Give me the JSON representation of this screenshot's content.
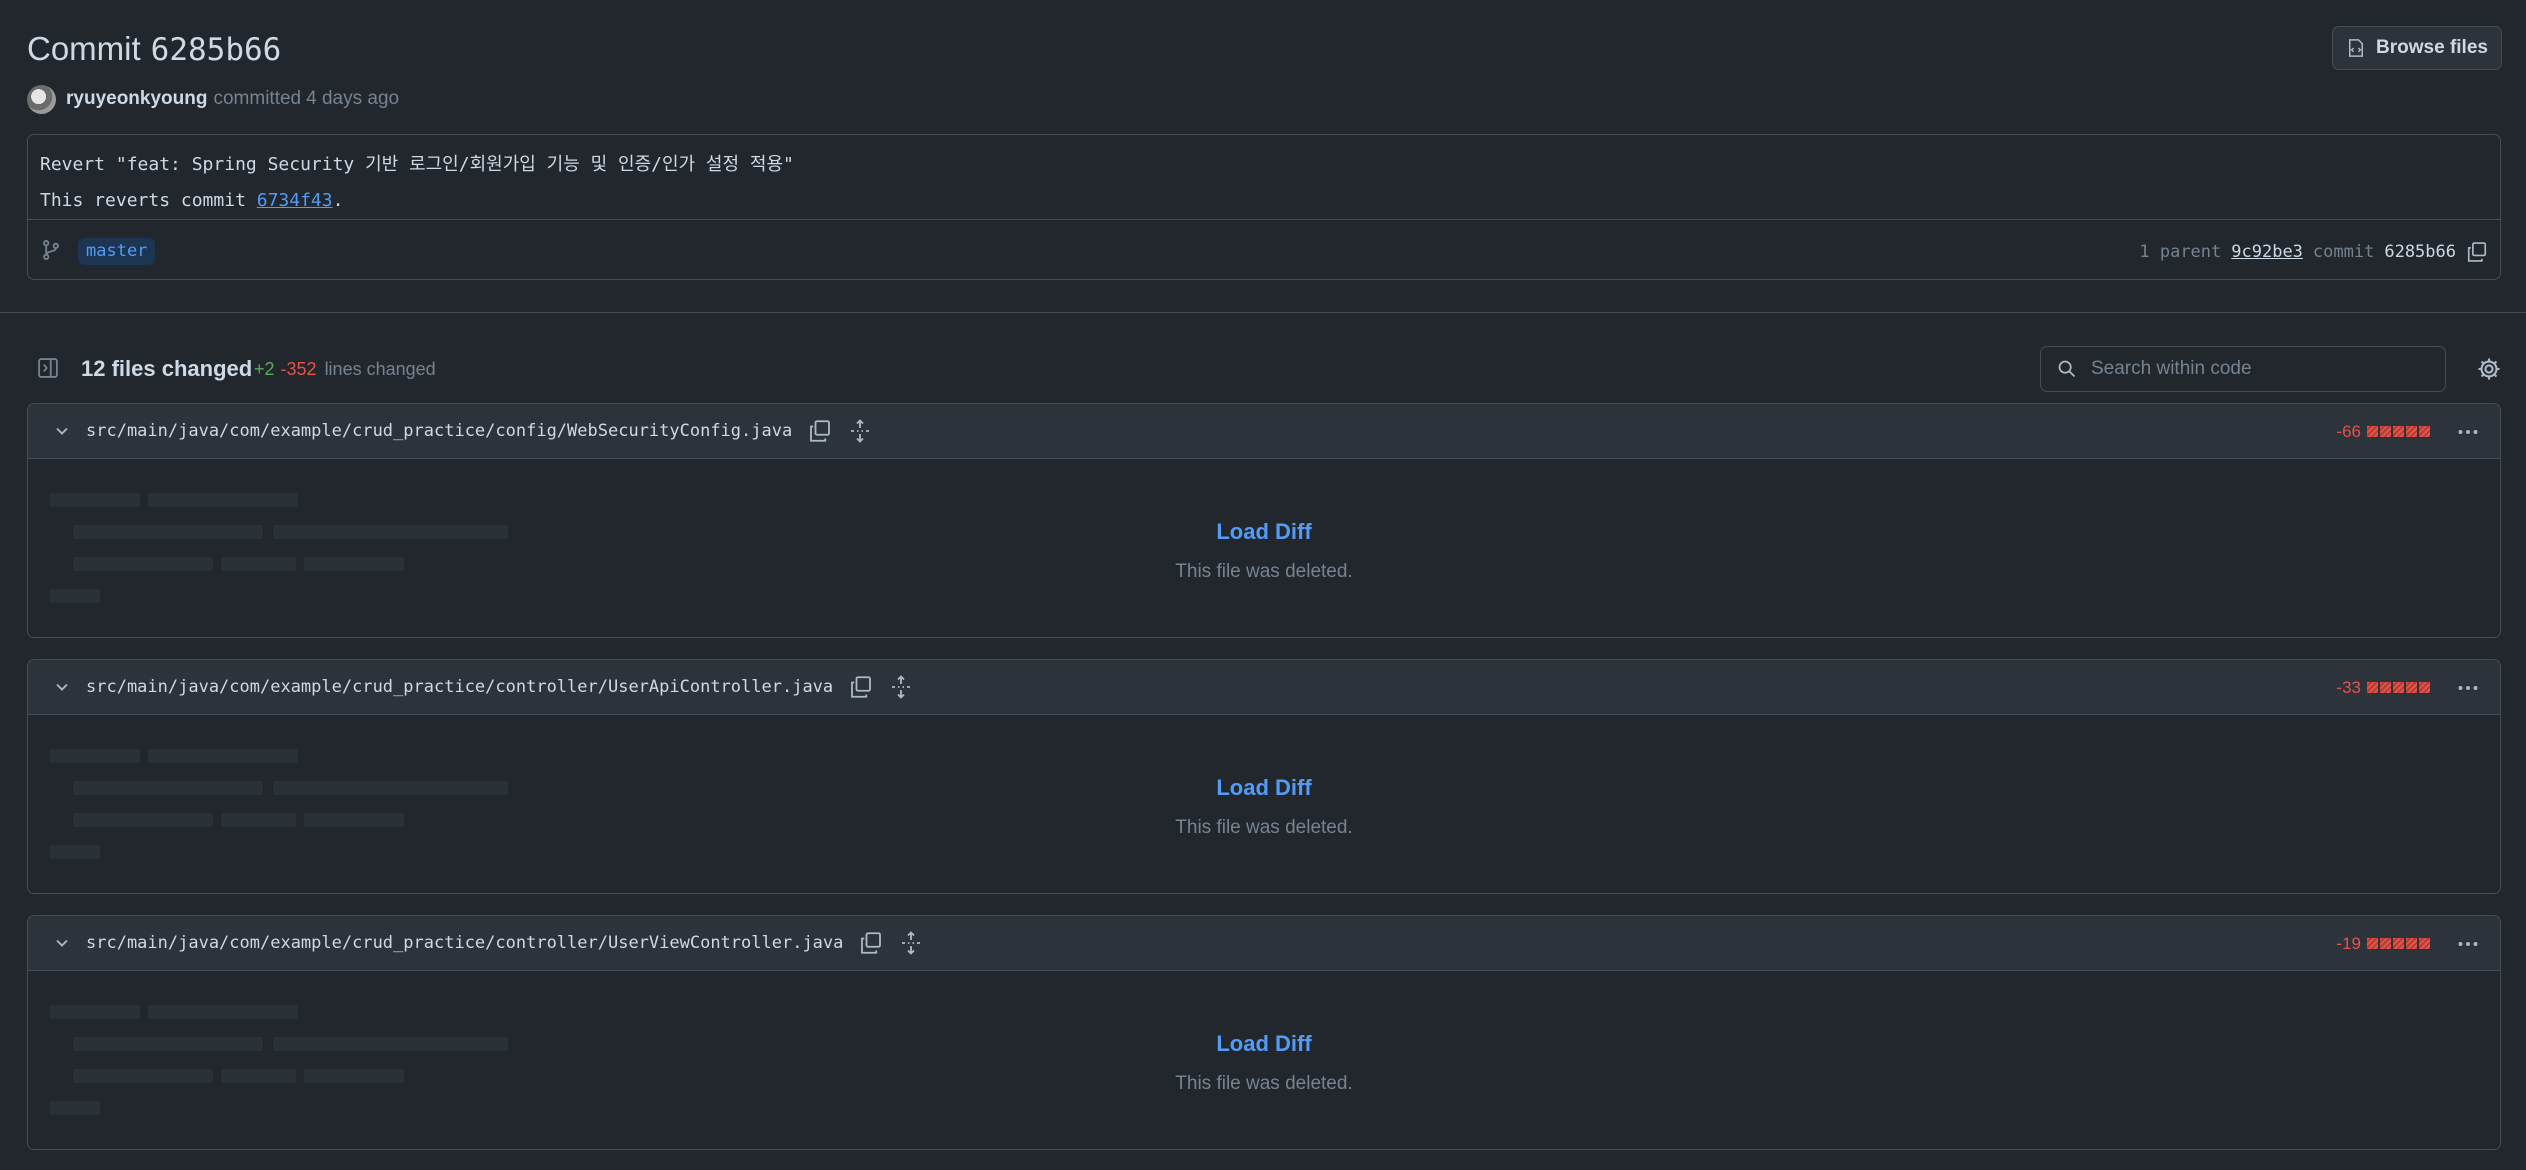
{
  "header": {
    "title_prefix": "Commit",
    "sha": "6285b66",
    "browse_label": "Browse files"
  },
  "author": {
    "name": "ryuyeonkyoung",
    "action": "committed",
    "time": "4 days ago"
  },
  "commit": {
    "message_title": "Revert \"feat: Spring Security 기반 로그인/회원가입 기능 및 인증/인가 설정 적용\"",
    "body_prefix": "This reverts commit ",
    "body_link": "6734f43",
    "body_suffix": ".",
    "branch": "master",
    "parent_label": "1 parent",
    "parent_sha": "9c92be3",
    "commit_label": "commit",
    "commit_sha": "6285b66"
  },
  "files_bar": {
    "count_label": "12 files changed",
    "additions": "+2",
    "deletions": "-352",
    "lines_label": "lines changed",
    "search_placeholder": "Search within code"
  },
  "files": [
    {
      "path": "src/main/java/com/example/crud_practice/config/WebSecurityConfig.java",
      "deleted": "-66",
      "load_label": "Load Diff",
      "status_text": "This file was deleted."
    },
    {
      "path": "src/main/java/com/example/crud_practice/controller/UserApiController.java",
      "deleted": "-33",
      "load_label": "Load Diff",
      "status_text": "This file was deleted."
    },
    {
      "path": "src/main/java/com/example/crud_practice/controller/UserViewController.java",
      "deleted": "-19",
      "load_label": "Load Diff",
      "status_text": "This file was deleted."
    }
  ],
  "colors": {
    "background": "#22272e",
    "accent": "#539bf5",
    "addition": "#57ab5a",
    "deletion": "#e5534b"
  },
  "icons": [
    "file-code-icon",
    "git-branch-icon",
    "copy-icon",
    "sidebar-expand-icon",
    "search-icon",
    "gear-icon",
    "chevron-down-icon",
    "unfold-icon",
    "kebab-horizontal-icon"
  ]
}
